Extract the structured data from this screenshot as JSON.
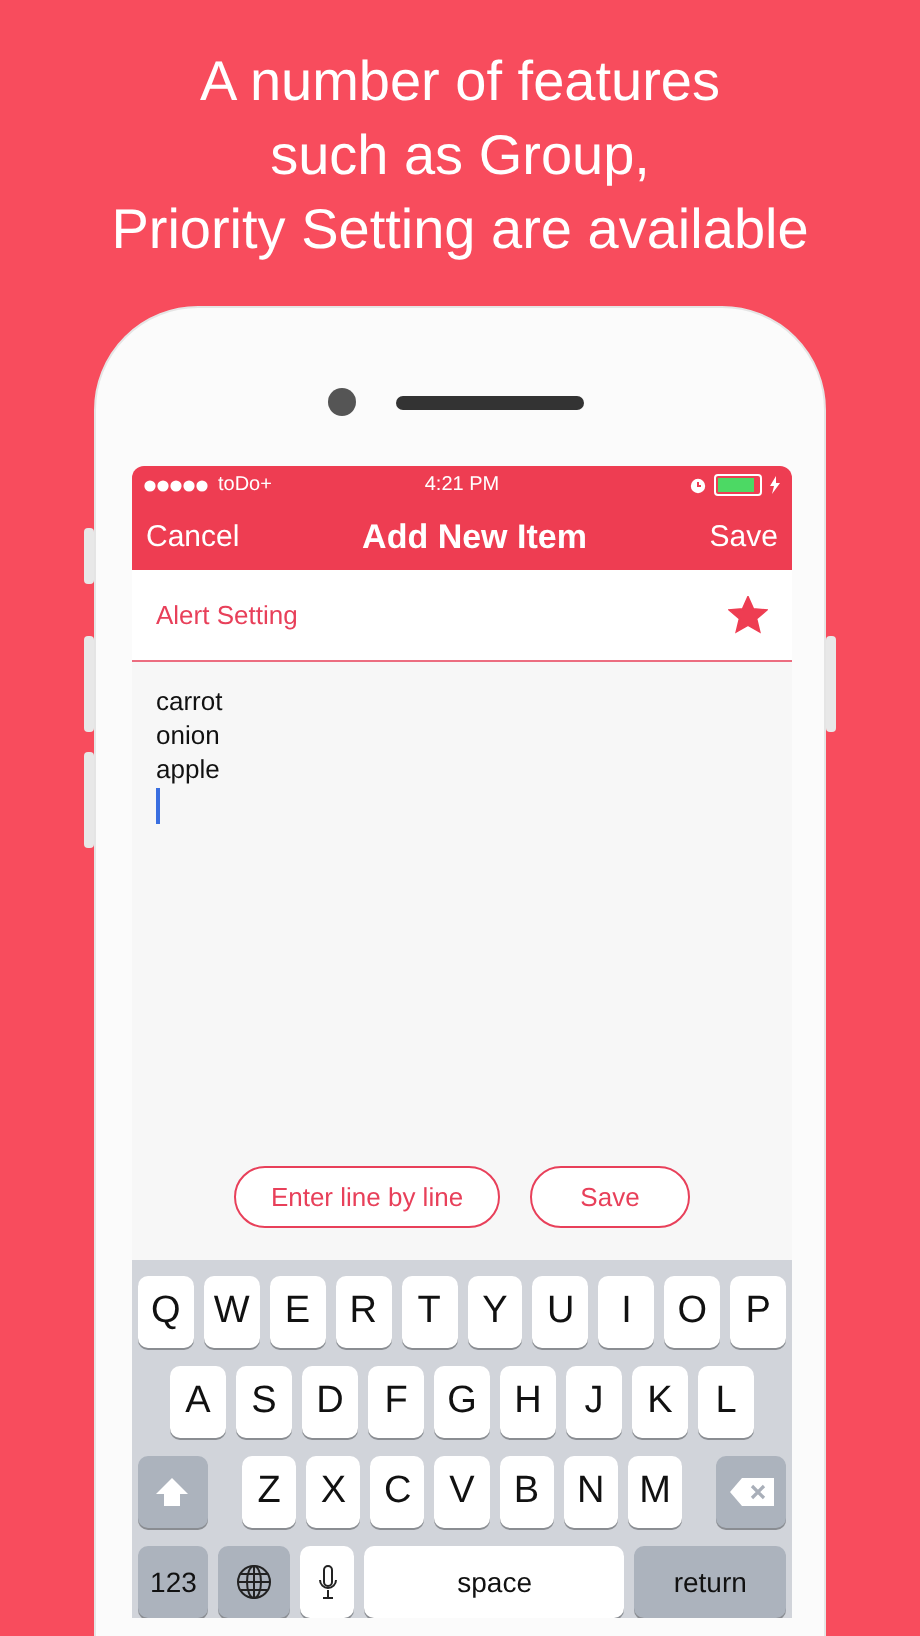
{
  "headline": [
    "A number of features",
    "such as Group,",
    "Priority Setting are available"
  ],
  "status_bar": {
    "carrier": "toDo+",
    "time": "4:21 PM"
  },
  "nav_bar": {
    "left": "Cancel",
    "title": "Add New Item",
    "right": "Save"
  },
  "alert_row": {
    "label": "Alert Setting",
    "starred": true
  },
  "note": {
    "text": "carrot\nonion\napple",
    "focused": true
  },
  "buttons": [
    {
      "label": "Enter line by line"
    },
    {
      "label": "Save"
    }
  ],
  "keyboard": {
    "rows": [
      {
        "keys": [
          {
            "kind": "letter",
            "label": "Q"
          },
          {
            "kind": "letter",
            "label": "W"
          },
          {
            "kind": "letter",
            "label": "E"
          },
          {
            "kind": "letter",
            "label": "R"
          },
          {
            "kind": "letter",
            "label": "T"
          },
          {
            "kind": "letter",
            "label": "Y"
          },
          {
            "kind": "letter",
            "label": "U"
          },
          {
            "kind": "letter",
            "label": "I"
          },
          {
            "kind": "letter",
            "label": "O"
          },
          {
            "kind": "letter",
            "label": "P"
          }
        ]
      },
      {
        "keys": [
          {
            "kind": "letter",
            "label": "A"
          },
          {
            "kind": "letter",
            "label": "S"
          },
          {
            "kind": "letter",
            "label": "D"
          },
          {
            "kind": "letter",
            "label": "F"
          },
          {
            "kind": "letter",
            "label": "G"
          },
          {
            "kind": "letter",
            "label": "H"
          },
          {
            "kind": "letter",
            "label": "J"
          },
          {
            "kind": "letter",
            "label": "K"
          },
          {
            "kind": "letter",
            "label": "L"
          }
        ]
      },
      {
        "keys": [
          {
            "kind": "shift"
          },
          {
            "kind": "letter",
            "label": "Z"
          },
          {
            "kind": "letter",
            "label": "X"
          },
          {
            "kind": "letter",
            "label": "C"
          },
          {
            "kind": "letter",
            "label": "V"
          },
          {
            "kind": "letter",
            "label": "B"
          },
          {
            "kind": "letter",
            "label": "N"
          },
          {
            "kind": "letter",
            "label": "M"
          },
          {
            "kind": "delete"
          }
        ]
      },
      {
        "keys": [
          {
            "kind": "numbers",
            "label": "123"
          },
          {
            "kind": "globe"
          },
          {
            "kind": "mic"
          },
          {
            "kind": "space",
            "label": "space"
          },
          {
            "kind": "return",
            "label": "return"
          }
        ]
      }
    ]
  }
}
